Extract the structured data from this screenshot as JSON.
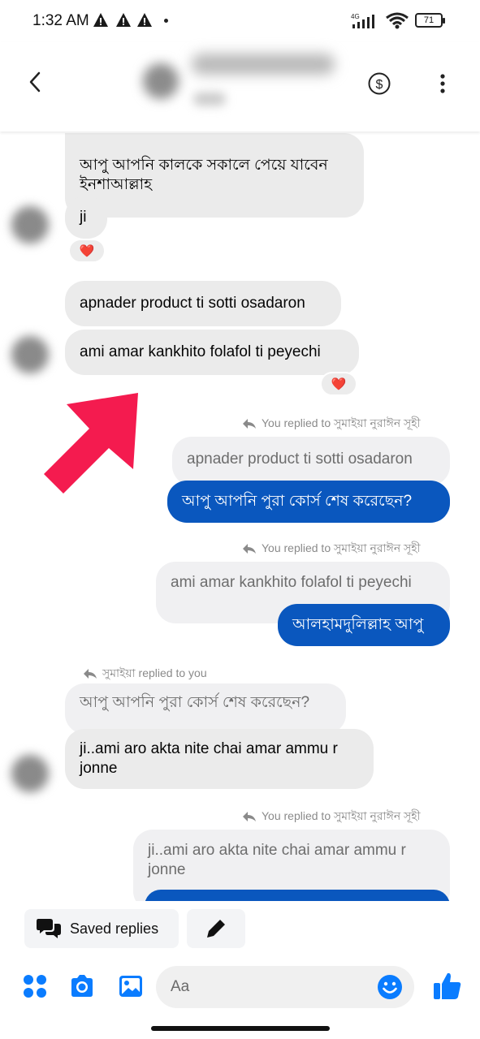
{
  "status_bar": {
    "time": "1:32 AM",
    "network": "4G",
    "battery": "71",
    "icons": [
      "warning-icon",
      "warning-icon",
      "warning-icon",
      "signal-icon",
      "wifi-icon",
      "battery-icon"
    ]
  },
  "header": {
    "icons": [
      "back-arrow-icon",
      "dollar-icon",
      "more-vertical-icon"
    ]
  },
  "messages": {
    "m1": "আপু আপনি কালকে সকালে পেয়ে যাবেন ইনশাআল্লাহ",
    "m2": "ji",
    "m3": "apnader product ti sotti osadaron",
    "m4": "ami amar kankhito folafol ti peyechi",
    "r1_note": "You replied to সুমাইয়া নুরাঈন সূহী",
    "r1_quote": "apnader product ti sotti osadaron",
    "r1_reply": "আপু আপনি পুরা কোর্স শেষ করেছেন?",
    "r2_note": "You replied to সুমাইয়া নুরাঈন সূহী",
    "r2_quote": "ami amar kankhito folafol ti peyechi",
    "r2_reply": "আলহামদুলিল্লাহ আপু",
    "r3_note": "সুমাইয়া replied to you",
    "r3_quote": "আপু আপনি পুরা কোর্স শেষ করেছেন?",
    "r3_reply": "ji..ami aro akta nite chai amar ammu r jonne",
    "r4_note": "You replied to সুমাইয়া নুরাঈন সূহী",
    "r4_quote": "ji..ami aro akta nite chai amar ammu r jonne"
  },
  "reactions": {
    "heart": "❤️"
  },
  "quick_actions": {
    "saved_replies": "Saved replies"
  },
  "composer": {
    "placeholder": "Aa",
    "icons": [
      "apps-icon",
      "camera-icon",
      "gallery-icon",
      "emoji-icon",
      "thumbs-up-icon"
    ]
  },
  "colors": {
    "accent": "#0a57be",
    "incoming": "#ebebeb",
    "quoted": "#f0f0f2",
    "arrow": "#f41b4f"
  }
}
